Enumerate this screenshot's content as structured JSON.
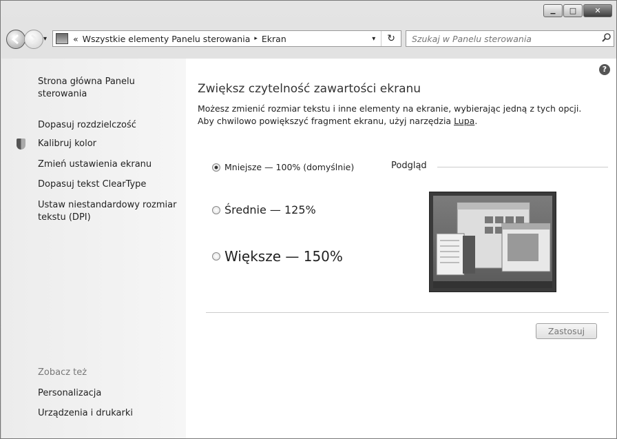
{
  "window": {
    "minimize_glyph": "▁",
    "maximize_glyph": "□",
    "close_glyph": "✕"
  },
  "address_bar": {
    "overflow": "«",
    "segments": [
      "Wszystkie elementy Panelu sterowania",
      "Ekran"
    ],
    "separator": "▸",
    "dropdown": "▾",
    "refresh": "↻"
  },
  "search": {
    "placeholder": "Szukaj w Panelu sterowania",
    "icon": "search-icon"
  },
  "sidebar": {
    "home": "Strona główna Panelu sterowania",
    "links": [
      "Dopasuj rozdzielczość",
      "Kalibruj kolor",
      "Zmień ustawienia ekranu",
      "Dopasuj tekst ClearType",
      "Ustaw niestandardowy rozmiar tekstu (DPI)"
    ],
    "see_also_heading": "Zobacz też",
    "see_also": [
      "Personalizacja",
      "Urządzenia i drukarki"
    ]
  },
  "main": {
    "help": "?",
    "title": "Zwiększ czytelność zawartości ekranu",
    "desc_line1": "Możesz zmienić rozmiar tekstu i inne elementy na ekranie, wybierając jedną z tych opcji.",
    "desc_line2_prefix": "Aby chwilowo powiększyć fragment ekranu, użyj narzędzia ",
    "desc_link": "Lupa",
    "desc_suffix": ".",
    "options": [
      {
        "label": "Mniejsze — 100% (domyślnie)",
        "selected": true
      },
      {
        "label": "Średnie — 125%",
        "selected": false
      },
      {
        "label": "Większe — 150%",
        "selected": false
      }
    ],
    "preview_label": "Podgląd",
    "apply_button": "Zastosuj"
  }
}
